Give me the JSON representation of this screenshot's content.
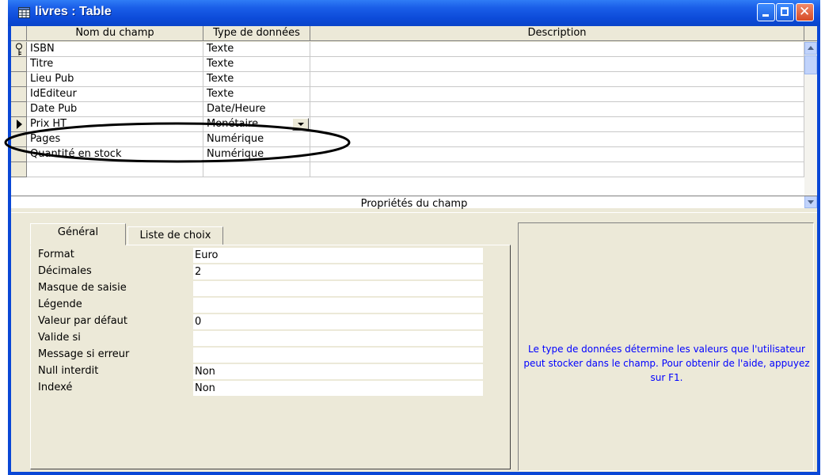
{
  "window": {
    "title": "livres : Table"
  },
  "grid": {
    "headers": [
      "Nom du champ",
      "Type de données",
      "Description"
    ],
    "rows": [
      {
        "name": "ISBN",
        "type": "Texte",
        "description": "",
        "primary_key": true
      },
      {
        "name": "Titre",
        "type": "Texte",
        "description": ""
      },
      {
        "name": "Lieu Pub",
        "type": "Texte",
        "description": ""
      },
      {
        "name": "IdEditeur",
        "type": "Texte",
        "description": ""
      },
      {
        "name": "Date Pub",
        "type": "Date/Heure",
        "description": ""
      },
      {
        "name": "Prix HT",
        "type": "Monétaire",
        "description": "",
        "current": true
      },
      {
        "name": "Pages",
        "type": "Numérique",
        "description": ""
      },
      {
        "name": "Quantité en stock",
        "type": "Numérique",
        "description": ""
      },
      {
        "name": "",
        "type": "",
        "description": ""
      }
    ]
  },
  "properties": {
    "section_title": "Propriétés du champ",
    "tabs": [
      "Général",
      "Liste de choix"
    ],
    "items": [
      {
        "label": "Format",
        "value": "Euro"
      },
      {
        "label": "Décimales",
        "value": "2"
      },
      {
        "label": "Masque de saisie",
        "value": ""
      },
      {
        "label": "Légende",
        "value": ""
      },
      {
        "label": "Valeur par défaut",
        "value": "0"
      },
      {
        "label": "Valide si",
        "value": ""
      },
      {
        "label": "Message si erreur",
        "value": ""
      },
      {
        "label": "Null interdit",
        "value": "Non"
      },
      {
        "label": "Indexé",
        "value": "Non"
      }
    ],
    "help_text": "Le type de données détermine les valeurs que l'utilisateur peut stocker dans le champ. Pour obtenir de l'aide, appuyez sur F1."
  },
  "icons": {
    "title": "table-icon",
    "primary_key": "key-icon",
    "current_row": "row-pointer-icon",
    "dropdown": "chevron-down-icon"
  },
  "colors": {
    "titlebar": "#0a47d6",
    "help_text": "#0000ff",
    "window_bg": "#ece9d8"
  }
}
